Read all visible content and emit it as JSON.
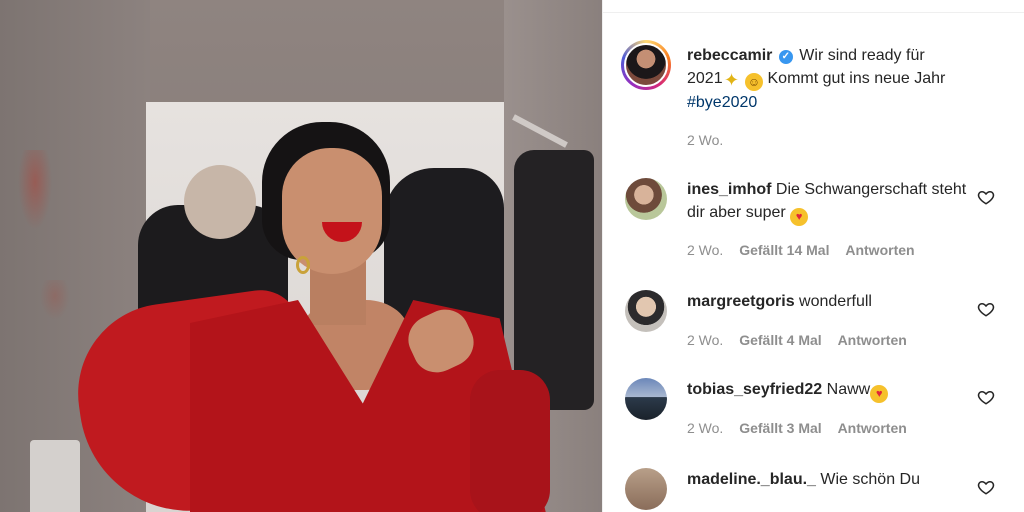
{
  "post": {
    "author": "rebeccamir",
    "caption_line1": "Wir sind ready für",
    "caption_year": "2021",
    "caption_line2": "Kommt gut ins neue Jahr",
    "hashtag": "#bye2020",
    "time": "2 Wo."
  },
  "comments": [
    {
      "user": "ines_imhof",
      "text": "Die Schwangerschaft steht dir aber super",
      "time": "2 Wo.",
      "likes": "Gefällt 14 Mal",
      "reply": "Antworten"
    },
    {
      "user": "margreetgoris",
      "text": "wonderfull",
      "time": "2 Wo.",
      "likes": "Gefällt 4 Mal",
      "reply": "Antworten"
    },
    {
      "user": "tobias_seyfried22",
      "text": "Naww",
      "time": "2 Wo.",
      "likes": "Gefällt 3 Mal",
      "reply": "Antworten"
    },
    {
      "user": "madeline._blau._",
      "text": "Wie schön Du"
    }
  ],
  "icons": {
    "verified": "verified-badge-icon",
    "like": "heart-outline-icon"
  },
  "colors": {
    "username": "#262626",
    "meta": "#8e8e8e",
    "hashtag": "#00376b",
    "verified": "#3897f0"
  }
}
